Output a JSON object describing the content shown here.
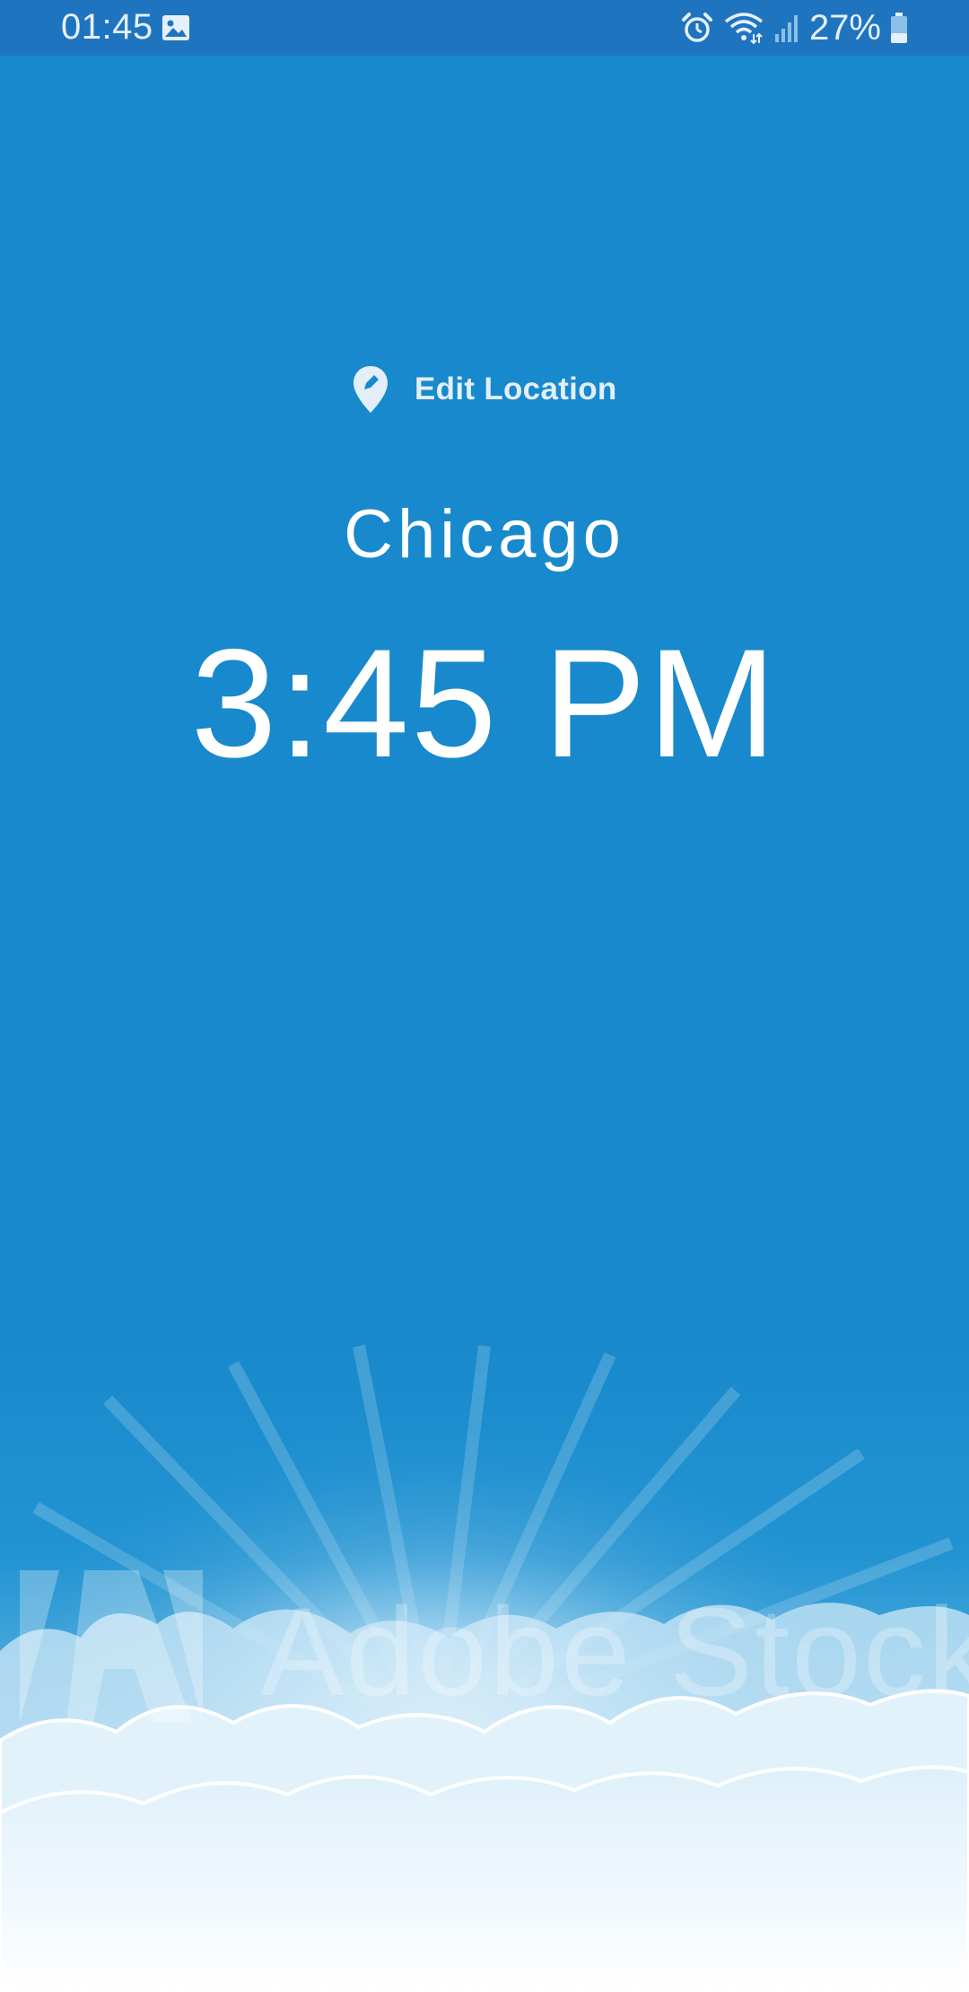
{
  "status_bar": {
    "time": "01:45",
    "battery": "27%",
    "icons": [
      "gallery-icon",
      "alarm-icon",
      "wifi-icon",
      "signal-icon",
      "battery-icon"
    ]
  },
  "location": {
    "edit_label": "Edit Location",
    "icon": "edit-location-pin-icon"
  },
  "clock": {
    "city": "Chicago",
    "time": "3:45 PM"
  },
  "watermark": {
    "text": "Adobe Stock"
  },
  "colors": {
    "background": "#1789cc",
    "status_bar": "#1f74c0",
    "text": "#ffffff"
  }
}
